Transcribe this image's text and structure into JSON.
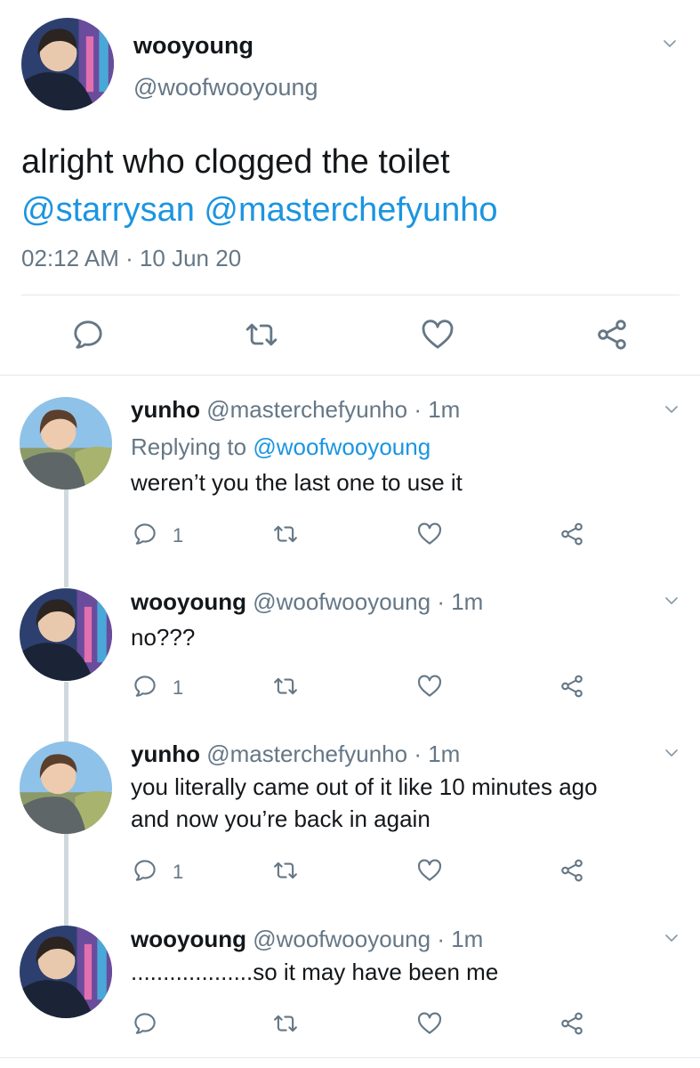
{
  "main_tweet": {
    "name": "wooyoung",
    "handle": "@woofwooyoung",
    "text": "alright who clogged the toilet",
    "mention1": "@starrysan",
    "mention2": "@masterchefyunho",
    "timestamp": "02:12 AM · 10 Jun 20"
  },
  "replies": [
    {
      "name": "yunho",
      "handle": "@masterchefyunho",
      "dot": "·",
      "time": "1m",
      "replying_prefix": "Replying to",
      "replying_to": "@woofwooyoung",
      "lines": [
        "weren’t you the last one to use it"
      ],
      "reply_count": "1"
    },
    {
      "name": "wooyoung",
      "handle": "@woofwooyoung",
      "dot": "·",
      "time": "1m",
      "lines": [
        "no???"
      ],
      "reply_count": "1"
    },
    {
      "name": "yunho",
      "handle": "@masterchefyunho",
      "dot": "·",
      "time": "1m",
      "lines": [
        "you literally came out of it like 10 minutes ago",
        "and now you’re back in again"
      ],
      "reply_count": "1"
    },
    {
      "name": "wooyoung",
      "handle": "@woofwooyoung",
      "dot": "·",
      "time": "1m",
      "lines": [
        "...................so it may have been me"
      ],
      "reply_count": ""
    }
  ],
  "icons": {
    "reply": "reply-icon",
    "retweet": "retweet-icon",
    "like": "heart-icon",
    "share": "share-icon",
    "menu": "chevron-down-icon"
  },
  "colors": {
    "mention": "#1b95e0",
    "muted": "#657786",
    "text": "#14171a",
    "divider": "#e1e8ed",
    "thread_line": "#cfd9de"
  }
}
